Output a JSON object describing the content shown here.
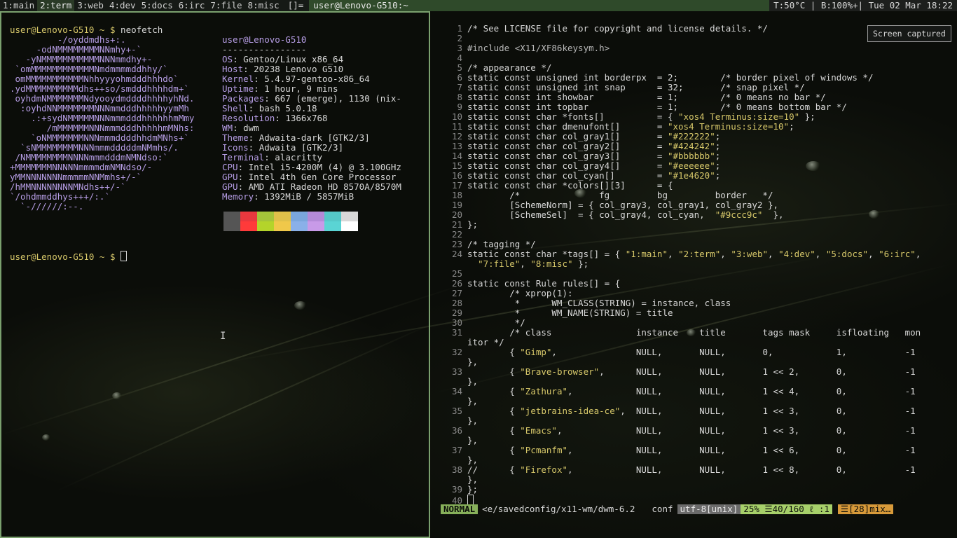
{
  "topbar": {
    "tags": [
      "1:main",
      "2:term",
      "3:web",
      "4:dev",
      "5:docs",
      "6:irc",
      "7:file",
      "8:misc"
    ],
    "selected_tag": "2:term",
    "layout_symbol": "[]=",
    "window_title": "user@Lenovo-G510:~",
    "status": "T:50°C | B:100%+| Tue 02 Mar 18:22"
  },
  "terminal": {
    "prompt": "user@Lenovo-G510 ~ $",
    "command": "neofetch",
    "ascii_art": [
      "         -/oyddmdhs+:.",
      "     -odNMMMMMMMMNNmhy+-`",
      "   -yNMMMMMMMMMMMNNNmmdhy+-",
      " `omMMMMMMMMMMMMNmdmmmmddhhy/`",
      " omMMMMMMMMMMMNhhyyyohmdddhhhdo`",
      ".ydMMMMMMMMMMdhs++so/smdddhhhhdm+`",
      " oyhdmNMMMMMMMNdyooydmddddhhhhyhNd.",
      "  :oyhdNNMMMMMMMNNNmmdddhhhhhyymMh",
      "    .:+sydNMMMMMNNNmmmdddhhhhhhmMmy",
      "       /mMMMMMMNNNmmmdddhhhhhmMNhs:",
      "    `oNMMMMMMMNNNmmmddddhhdmMNhs+`",
      "  `sNMMMMMMMMNNNmmmdddddmNMmhs/.",
      " /NMMMMMMMMNNNNmmmdddmNMNdso:`",
      "+MMMMMMMNNNNNmmmmdmNMNdso/-",
      "yMMNNNNNNNmmmmmNNMmhs+/-`",
      "/hMMNNNNNNNNMNdhs++/-`",
      "`/ohdmmddhys+++/:.`",
      "  `-//////:--."
    ],
    "info_title": "user@Lenovo-G510",
    "info_separator": "----------------",
    "info": [
      {
        "key": "OS",
        "value": "Gentoo/Linux x86_64"
      },
      {
        "key": "Host",
        "value": "20238 Lenovo G510"
      },
      {
        "key": "Kernel",
        "value": "5.4.97-gentoo-x86_64"
      },
      {
        "key": "Uptime",
        "value": "1 hour, 9 mins"
      },
      {
        "key": "Packages",
        "value": "667 (emerge), 1130 (nix-"
      },
      {
        "key": "Shell",
        "value": "bash 5.0.18"
      },
      {
        "key": "Resolution",
        "value": "1366x768"
      },
      {
        "key": "WM",
        "value": "dwm"
      },
      {
        "key": "Theme",
        "value": "Adwaita-dark [GTK2/3]"
      },
      {
        "key": "Icons",
        "value": "Adwaita [GTK2/3]"
      },
      {
        "key": "Terminal",
        "value": "alacritty"
      },
      {
        "key": "CPU",
        "value": "Intel i5-4200M (4) @ 3.100GHz"
      },
      {
        "key": "GPU",
        "value": "Intel 4th Gen Core Processor"
      },
      {
        "key": "GPU",
        "value": "AMD ATI Radeon HD 8570A/8570M"
      },
      {
        "key": "Memory",
        "value": "1392MiB / 5857MiB"
      }
    ],
    "palette": [
      "#555555",
      "#e8383e",
      "#a4c43a",
      "#e0c04a",
      "#7aa6dc",
      "#b48ad8",
      "#55c8c8",
      "#d8d8d8",
      "#555555",
      "#ff3a3a",
      "#b4d42a",
      "#f0c84a",
      "#8ab0e8",
      "#c89ae8",
      "#5ad4d4",
      "#ffffff"
    ],
    "prompt2": "user@Lenovo-G510 ~ $"
  },
  "toast": {
    "text": "Screen captured"
  },
  "editor": {
    "lines": [
      {
        "n": "1",
        "t": "/* See LICENSE file for copyright and license details. */"
      },
      {
        "n": "2",
        "t": ""
      },
      {
        "n": "3",
        "t": "#include <X11/XF86keysym.h>"
      },
      {
        "n": "4",
        "t": ""
      },
      {
        "n": "5",
        "t": "/* appearance */"
      },
      {
        "n": "6",
        "t": "static const unsigned int borderpx  = 2;        /* border pixel of windows */"
      },
      {
        "n": "7",
        "t": "static const unsigned int snap      = 32;       /* snap pixel */"
      },
      {
        "n": "8",
        "t": "static const int showbar            = 1;        /* 0 means no bar */"
      },
      {
        "n": "9",
        "t": "static const int topbar             = 1;        /* 0 means bottom bar */"
      },
      {
        "n": "10",
        "t": "static const char *fonts[]          = { \"xos4 Terminus:size=10\" };"
      },
      {
        "n": "11",
        "t": "static const char dmenufont[]       = \"xos4 Terminus:size=10\";"
      },
      {
        "n": "12",
        "t": "static const char col_gray1[]       = \"#222222\";"
      },
      {
        "n": "13",
        "t": "static const char col_gray2[]       = \"#424242\";"
      },
      {
        "n": "14",
        "t": "static const char col_gray3[]       = \"#bbbbbb\";"
      },
      {
        "n": "15",
        "t": "static const char col_gray4[]       = \"#eeeeee\";"
      },
      {
        "n": "16",
        "t": "static const char col_cyan[]        = \"#1e4620\";"
      },
      {
        "n": "17",
        "t": "static const char *colors[][3]      = {"
      },
      {
        "n": "18",
        "t": "        /*               fg         bg         border   */"
      },
      {
        "n": "19",
        "t": "        [SchemeNorm] = { col_gray3, col_gray1, col_gray2 },"
      },
      {
        "n": "20",
        "t": "        [SchemeSel]  = { col_gray4, col_cyan,  \"#9ccc9c\"  },"
      },
      {
        "n": "21",
        "t": "};"
      },
      {
        "n": "22",
        "t": ""
      },
      {
        "n": "23",
        "t": "/* tagging */"
      },
      {
        "n": "24",
        "t": "static const char *tags[] = { \"1:main\", \"2:term\", \"3:web\", \"4:dev\", \"5:docs\", \"6:irc\","
      },
      {
        "n": "",
        "t": "  \"7:file\", \"8:misc\" };"
      },
      {
        "n": "25",
        "t": ""
      },
      {
        "n": "26",
        "t": "static const Rule rules[] = {"
      },
      {
        "n": "27",
        "t": "        /* xprop(1):"
      },
      {
        "n": "28",
        "t": "         *      WM_CLASS(STRING) = instance, class"
      },
      {
        "n": "29",
        "t": "         *      WM_NAME(STRING) = title"
      },
      {
        "n": "30",
        "t": "         */"
      },
      {
        "n": "31",
        "t": "        /* class                instance    title       tags mask     isfloating   mon"
      },
      {
        "n": "",
        "t": "itor */"
      },
      {
        "n": "32",
        "t": "        { \"Gimp\",               NULL,       NULL,       0,            1,           -1"
      },
      {
        "n": "",
        "t": "},"
      },
      {
        "n": "33",
        "t": "        { \"Brave-browser\",      NULL,       NULL,       1 << 2,       0,           -1"
      },
      {
        "n": "",
        "t": "},"
      },
      {
        "n": "34",
        "t": "        { \"Zathura\",            NULL,       NULL,       1 << 4,       0,           -1"
      },
      {
        "n": "",
        "t": "},"
      },
      {
        "n": "35",
        "t": "        { \"jetbrains-idea-ce\",  NULL,       NULL,       1 << 3,       0,           -1"
      },
      {
        "n": "",
        "t": "},"
      },
      {
        "n": "36",
        "t": "        { \"Emacs\",              NULL,       NULL,       1 << 3,       0,           -1"
      },
      {
        "n": "",
        "t": "},"
      },
      {
        "n": "37",
        "t": "        { \"Pcmanfm\",            NULL,       NULL,       1 << 6,       0,           -1"
      },
      {
        "n": "",
        "t": "},"
      },
      {
        "n": "38",
        "t": "//      { \"Firefox\",            NULL,       NULL,       1 << 8,       0,           -1"
      },
      {
        "n": "",
        "t": "},"
      },
      {
        "n": "39",
        "t": "};"
      },
      {
        "n": "40",
        "t": ""
      }
    ],
    "status": {
      "mode": "NORMAL",
      "path": "<e/savedconfig/x11-wm/dwm-6.2",
      "filetype": "conf",
      "encoding": "utf-8[unix]",
      "position": "25% ☰40/160 ℓ :1",
      "warning": "☰[28]mix…"
    }
  }
}
